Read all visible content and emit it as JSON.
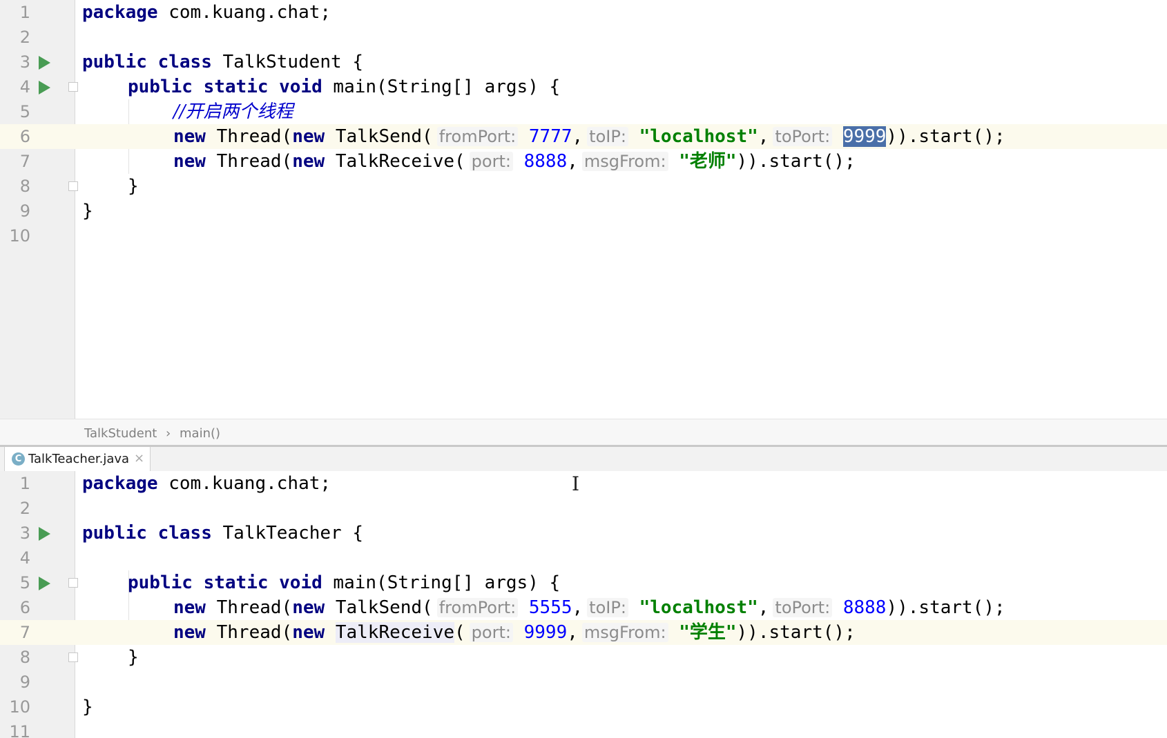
{
  "top_editor": {
    "lines": [
      {
        "n": "1",
        "package_kw": "package",
        "package_name": " com.kuang.chat;"
      },
      {
        "n": "2"
      },
      {
        "n": "3",
        "kw1": "public",
        "kw2": "class",
        "rest": " TalkStudent {"
      },
      {
        "n": "4",
        "kw1": "public",
        "kw2": "static",
        "kw3": "void",
        "rest": " main(String[] args) {"
      },
      {
        "n": "5",
        "comment": "//开启两个线程"
      },
      {
        "n": "6",
        "kw_new1": "new",
        "t1": " Thread(",
        "kw_new2": "new",
        "t2": " TalkSend(",
        "h1": "fromPort:",
        "v1": "7777",
        "c1": ",",
        "h2": "toIP:",
        "v2": "\"localhost\"",
        "c2": ",",
        "h3": "toPort:",
        "v3": "9999",
        "tail": ")).start();"
      },
      {
        "n": "7",
        "kw_new1": "new",
        "t1": " Thread(",
        "kw_new2": "new",
        "t2": " TalkReceive(",
        "h1": "port:",
        "v1": "8888",
        "c1": ",",
        "h2": "msgFrom:",
        "v2": "\"老师\"",
        "tail": ")).start();"
      },
      {
        "n": "8",
        "rest": "}"
      },
      {
        "n": "9",
        "rest": "}"
      },
      {
        "n": "10"
      }
    ]
  },
  "breadcrumb": {
    "class": "TalkStudent",
    "sep": "›",
    "method": "main()"
  },
  "tab": {
    "icon": "C",
    "label": "TalkTeacher.java",
    "close": "×"
  },
  "bottom_editor": {
    "lines": [
      {
        "n": "1",
        "package_kw": "package",
        "package_name": " com.kuang.chat;"
      },
      {
        "n": "2"
      },
      {
        "n": "3",
        "kw1": "public",
        "kw2": "class",
        "rest": " TalkTeacher {"
      },
      {
        "n": "4"
      },
      {
        "n": "5",
        "kw1": "public",
        "kw2": "static",
        "kw3": "void",
        "rest": " main(String[] args) {"
      },
      {
        "n": "6",
        "kw_new1": "new",
        "t1": " Thread(",
        "kw_new2": "new",
        "t2": " TalkSend(",
        "h1": "fromPort:",
        "v1": "5555",
        "c1": ",",
        "h2": "toIP:",
        "v2": "\"localhost\"",
        "c2": ",",
        "h3": "toPort:",
        "v3": "8888",
        "tail": ")).start();"
      },
      {
        "n": "7",
        "kw_new1": "new",
        "t1": " Thread(",
        "kw_new2": "new",
        "t2a": " ",
        "t2b": "TalkReceive",
        "t2c": "(",
        "h1": "port:",
        "v1": "9999",
        "c1": ",",
        "h2": "msgFrom:",
        "v2": "\"学生\"",
        "tail": ")).start();"
      },
      {
        "n": "8",
        "rest": "}"
      },
      {
        "n": "9"
      },
      {
        "n": "10",
        "rest": "}"
      },
      {
        "n": "11"
      }
    ]
  },
  "colors": {
    "keyword": "#000080",
    "number": "#0000ff",
    "string": "#008000",
    "hint": "#8c8c8c",
    "selection": "#4a6fa8",
    "run_icon": "#499c54"
  },
  "icons": {
    "run": "run-gutter-icon",
    "fold": "fold-icon",
    "cursor": "text-cursor-icon"
  }
}
